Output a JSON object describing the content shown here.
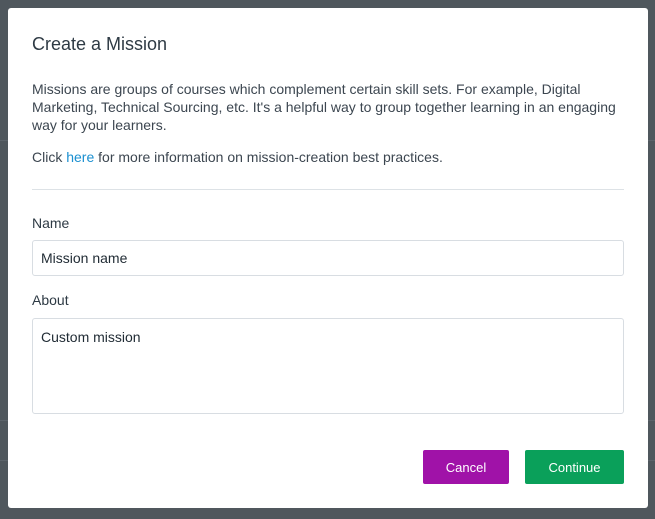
{
  "modal": {
    "title": "Create a Mission",
    "description": "Missions are groups of courses which complement certain skill sets. For example, Digital Marketing, Technical Sourcing, etc. It's a helpful way to group together learning in an engaging way for your learners.",
    "help_prefix": "Click ",
    "help_link": "here",
    "help_suffix": " for more information on mission-creation best practices.",
    "name_label": "Name",
    "name_value": "Mission name",
    "about_label": "About",
    "about_value": "Custom mission",
    "cancel_label": "Cancel",
    "continue_label": "Continue"
  },
  "colors": {
    "cancel": "#a012a8",
    "continue": "#0aa05a",
    "link": "#1a8fd0"
  }
}
